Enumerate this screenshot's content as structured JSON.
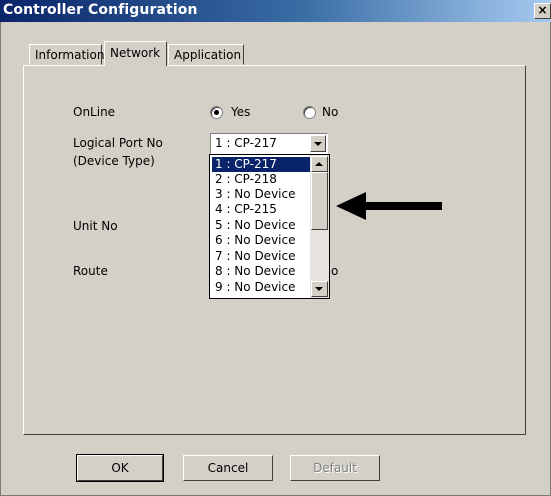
{
  "window": {
    "title": "Controller Configuration",
    "close_glyph": "×"
  },
  "tabs": [
    {
      "label": "Information",
      "active": false
    },
    {
      "label": "Network",
      "active": true
    },
    {
      "label": "Application",
      "active": false
    }
  ],
  "form": {
    "online_label": "OnLine",
    "online_yes": "Yes",
    "online_no": "No",
    "online_selected": "Yes",
    "logical_port_label": "Logical Port No",
    "device_type_label": "(Device Type)",
    "logical_port_value": "1 : CP-217",
    "unit_no_label": "Unit No",
    "route_label": "Route",
    "route_value_fragment": "o"
  },
  "dropdown": {
    "items": [
      "1 : CP-217",
      "2 : CP-218",
      "3 : No Device",
      "4 : CP-215",
      "5 : No Device",
      "6 : No Device",
      "7 : No Device",
      "8 : No Device",
      "9 : No Device"
    ],
    "selected_index": 0
  },
  "buttons": {
    "ok": "OK",
    "cancel": "Cancel",
    "default": "Default"
  },
  "colors": {
    "title_bar": "#0a246a",
    "selection": "#0a246a",
    "face": "#d4d0c8"
  },
  "icons": {
    "pointer_arrow": "arrow-left-icon"
  }
}
